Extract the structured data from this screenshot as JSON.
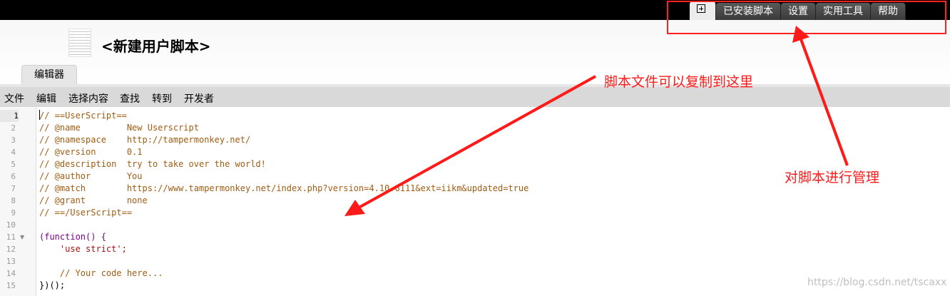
{
  "top_tabs": [
    {
      "label": ""
    },
    {
      "label": "已安装脚本"
    },
    {
      "label": "设置"
    },
    {
      "label": "实用工具"
    },
    {
      "label": "帮助"
    }
  ],
  "script_title": "<新建用户脚本>",
  "editor_tab": "编辑器",
  "menu": [
    "文件",
    "编辑",
    "选择内容",
    "查找",
    "转到",
    "开发者"
  ],
  "code_lines": [
    "// ==UserScript==",
    "// @name         New Userscript",
    "// @namespace    http://tampermonkey.net/",
    "// @version      0.1",
    "// @description  try to take over the world!",
    "// @author       You",
    "// @match        https://www.tampermonkey.net/index.php?version=4.10.6111&ext=iikm&updated=true",
    "// @grant        none",
    "// ==/UserScript==",
    "",
    "(function() {",
    "    'use strict';",
    "",
    "    // Your code here...",
    "})();"
  ],
  "line_numbers": [
    "1",
    "2",
    "3",
    "4",
    "5",
    "6",
    "7",
    "8",
    "9",
    "10",
    "11",
    "12",
    "13",
    "14",
    "15"
  ],
  "annotations": {
    "copy_here": "脚本文件可以复制到这里",
    "manage": "对脚本进行管理"
  },
  "watermark": "https://blog.csdn.net/tscaxx",
  "colors": {
    "annotation": "#ff1a1a",
    "comment": "#a15c12",
    "string": "#aa1111",
    "keyword": "#770088"
  }
}
